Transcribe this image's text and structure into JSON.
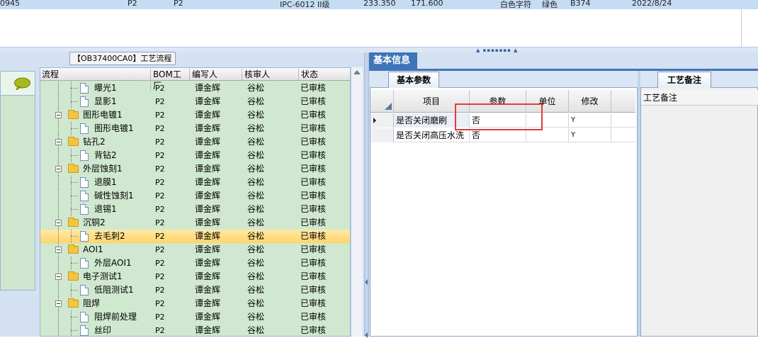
{
  "top_row": [
    "0945",
    "P2",
    "P2",
    "IPC-6012 II级",
    "233.350",
    "171.600",
    "白色字符",
    "绿色",
    "B374",
    "2022/8/24"
  ],
  "left_tab_label": "【OB37400CA0】工艺流程",
  "tree": {
    "columns": [
      "流程",
      "BOM工厂",
      "编写人",
      "核审人",
      "状态"
    ],
    "rows": [
      {
        "level": 1,
        "type": "doc",
        "name": "曝光1",
        "bom": "P2",
        "author": "谭金辉",
        "reviewer": "谷松",
        "status": "已审核"
      },
      {
        "level": 1,
        "type": "doc",
        "name": "显影1",
        "bom": "P2",
        "author": "谭金辉",
        "reviewer": "谷松",
        "status": "已审核"
      },
      {
        "level": 0,
        "type": "folder",
        "name": "图形电镀1",
        "bom": "P2",
        "author": "谭金辉",
        "reviewer": "谷松",
        "status": "已审核"
      },
      {
        "level": 1,
        "type": "doc",
        "name": "图形电镀1",
        "bom": "P2",
        "author": "谭金辉",
        "reviewer": "谷松",
        "status": "已审核"
      },
      {
        "level": 0,
        "type": "folder",
        "name": "钻孔2",
        "bom": "P2",
        "author": "谭金辉",
        "reviewer": "谷松",
        "status": "已审核"
      },
      {
        "level": 1,
        "type": "doc",
        "name": "背钻2",
        "bom": "P2",
        "author": "谭金辉",
        "reviewer": "谷松",
        "status": "已审核"
      },
      {
        "level": 0,
        "type": "folder",
        "name": "外层蚀刻1",
        "bom": "P2",
        "author": "谭金辉",
        "reviewer": "谷松",
        "status": "已审核"
      },
      {
        "level": 1,
        "type": "doc",
        "name": "退膜1",
        "bom": "P2",
        "author": "谭金辉",
        "reviewer": "谷松",
        "status": "已审核"
      },
      {
        "level": 1,
        "type": "doc",
        "name": "碱性蚀刻1",
        "bom": "P2",
        "author": "谭金辉",
        "reviewer": "谷松",
        "status": "已审核"
      },
      {
        "level": 1,
        "type": "doc",
        "name": "退锡1",
        "bom": "P2",
        "author": "谭金辉",
        "reviewer": "谷松",
        "status": "已审核"
      },
      {
        "level": 0,
        "type": "folder",
        "name": "沉铜2",
        "bom": "P2",
        "author": "谭金辉",
        "reviewer": "谷松",
        "status": "已审核"
      },
      {
        "level": 1,
        "type": "doc",
        "name": "去毛刺2",
        "bom": "P2",
        "author": "谭金辉",
        "reviewer": "谷松",
        "status": "已审核",
        "selected": true
      },
      {
        "level": 0,
        "type": "folder",
        "name": "AOI1",
        "bom": "P2",
        "author": "谭金辉",
        "reviewer": "谷松",
        "status": "已审核"
      },
      {
        "level": 1,
        "type": "doc",
        "name": "外层AOI1",
        "bom": "P2",
        "author": "谭金辉",
        "reviewer": "谷松",
        "status": "已审核"
      },
      {
        "level": 0,
        "type": "folder",
        "name": "电子测试1",
        "bom": "P2",
        "author": "谭金辉",
        "reviewer": "谷松",
        "status": "已审核"
      },
      {
        "level": 1,
        "type": "doc",
        "name": "低阻测试1",
        "bom": "P2",
        "author": "谭金辉",
        "reviewer": "谷松",
        "status": "已审核"
      },
      {
        "level": 0,
        "type": "folder",
        "name": "阻焊",
        "bom": "P2",
        "author": "谭金辉",
        "reviewer": "谷松",
        "status": "已审核"
      },
      {
        "level": 1,
        "type": "doc",
        "name": "阻焊前处理",
        "bom": "P2",
        "author": "谭金辉",
        "reviewer": "谷松",
        "status": "已审核"
      },
      {
        "level": 1,
        "type": "doc",
        "name": "丝印",
        "bom": "P2",
        "author": "谭金辉",
        "reviewer": "谷松",
        "status": "已审核"
      }
    ]
  },
  "basic_info_tab": "基本信息",
  "param_tab": "基本参数",
  "grid": {
    "columns": [
      "项目",
      "参数",
      "单位",
      "修改"
    ],
    "rows": [
      {
        "item": "是否关闭磨刷",
        "value": "否",
        "unit": "",
        "modify": "Y",
        "current": true
      },
      {
        "item": "是否关闭高压水洗",
        "value": "否",
        "unit": "",
        "modify": "Y",
        "current": false
      }
    ]
  },
  "note_tab": "工艺备注",
  "note_header": "工艺备注"
}
